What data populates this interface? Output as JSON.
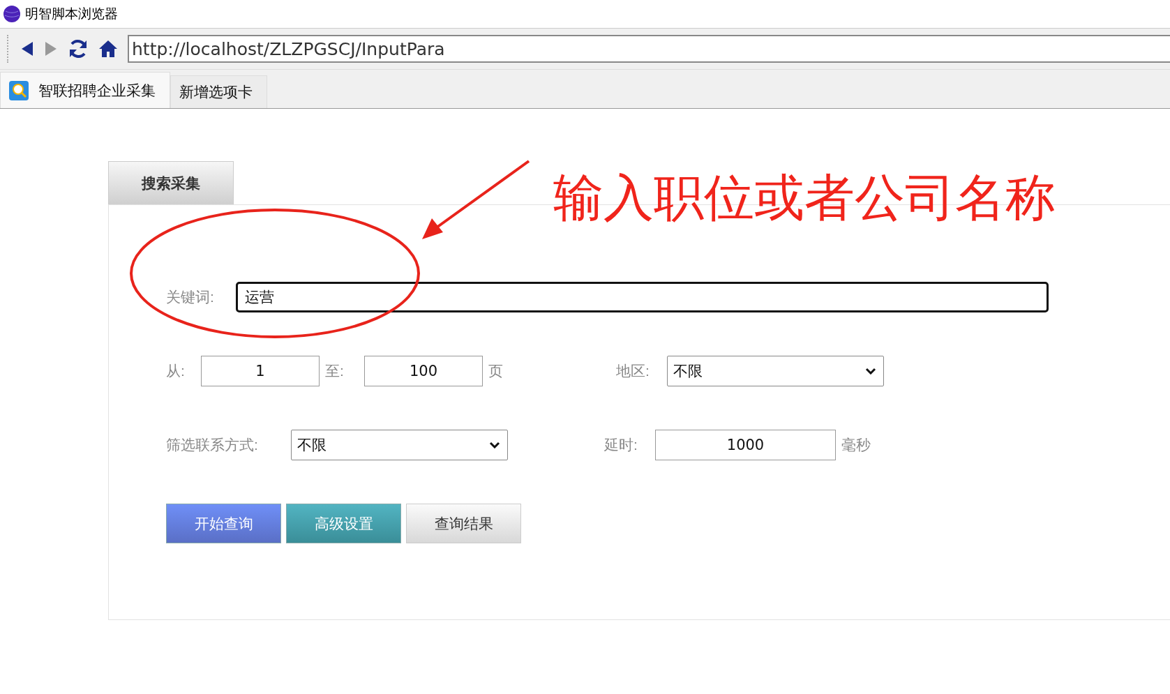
{
  "window": {
    "title": "明智脚本浏览器"
  },
  "address_bar": {
    "value": "http://localhost/ZLZPGSCJ/InputPara"
  },
  "browser_tabs": [
    {
      "label": "智联招聘企业采集",
      "selected": true
    },
    {
      "label": "新增选项卡",
      "selected": false
    }
  ],
  "panel": {
    "tabs": [
      {
        "label": "搜索采集",
        "selected": true
      }
    ],
    "keyword": {
      "label": "关键词:",
      "value": "运营"
    },
    "page_from": {
      "label": "从:",
      "value": "1"
    },
    "page_to": {
      "label": "至:",
      "value": "100"
    },
    "page_unit": "页",
    "region": {
      "label": "地区:",
      "value": "不限"
    },
    "contact_filter": {
      "label": "筛选联系方式:",
      "value": "不限"
    },
    "delay": {
      "label": "延时:",
      "value": "1000",
      "unit": "毫秒"
    },
    "buttons": [
      {
        "label": "开始查询",
        "kind": "primary"
      },
      {
        "label": "高级设置",
        "kind": "info"
      },
      {
        "label": "查询结果",
        "kind": "default"
      }
    ]
  },
  "annotation": {
    "text": "输入职位或者公司名称"
  }
}
